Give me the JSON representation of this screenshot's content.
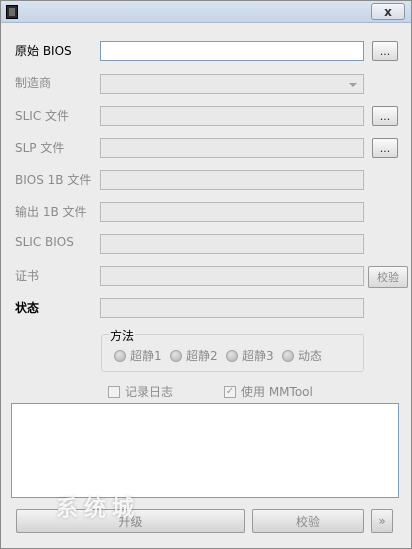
{
  "window": {
    "title": "",
    "close_label": "x"
  },
  "form": {
    "bios": {
      "label": "原始 BIOS",
      "value": "",
      "browse": "..."
    },
    "manufacturer": {
      "label": "制造商",
      "value": ""
    },
    "slic_file": {
      "label": "SLIC 文件",
      "value": "",
      "browse": "..."
    },
    "slp_file": {
      "label": "SLP 文件",
      "value": "",
      "browse": "..."
    },
    "bios_1b": {
      "label": "BIOS 1B 文件",
      "value": ""
    },
    "out_1b": {
      "label": "输出 1B 文件",
      "value": ""
    },
    "slic_bios": {
      "label": "SLIC BIOS",
      "value": ""
    },
    "cert": {
      "label": "证书",
      "value": "",
      "verify": "校验"
    },
    "status": {
      "label": "状态",
      "value": ""
    }
  },
  "method": {
    "title": "方法",
    "options": [
      "超静1",
      "超静2",
      "超静3",
      "动态"
    ]
  },
  "options": {
    "log": {
      "label": "记录日志",
      "checked": false,
      "mark": ""
    },
    "mmtool": {
      "label": "使用 MMTool",
      "checked": true,
      "mark": "✓"
    }
  },
  "buttons": {
    "upgrade": "升级",
    "verify": "校验",
    "more": "»"
  },
  "watermark": "系统城"
}
